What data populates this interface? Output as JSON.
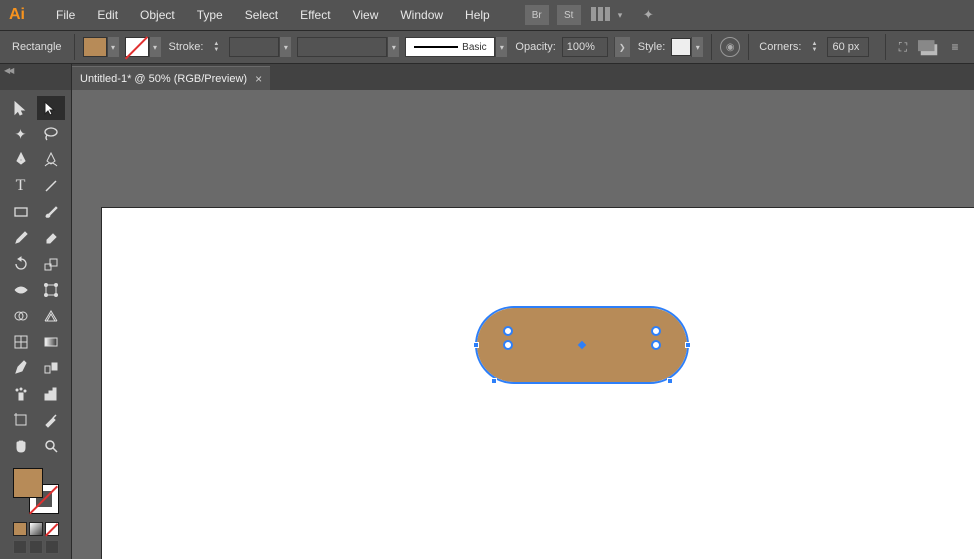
{
  "app_icon_text": "Ai",
  "menu": [
    "File",
    "Edit",
    "Object",
    "Type",
    "Select",
    "Effect",
    "View",
    "Window",
    "Help"
  ],
  "bridge_label": "Br",
  "stock_label": "St",
  "controlbar": {
    "shape_label": "Rectangle",
    "stroke_label": "Stroke:",
    "brush_label": "Basic",
    "opacity_label": "Opacity:",
    "opacity_value": "100%",
    "style_label": "Style:",
    "corners_label": "Corners:",
    "corners_value": "60 px"
  },
  "tab": {
    "title": "Untitled-1* @ 50% (RGB/Preview)",
    "close": "×"
  },
  "colors": {
    "fill": "#b78b58",
    "selection": "#2d7ff9"
  },
  "tools": [
    [
      "selection-tool",
      "direct-selection-tool"
    ],
    [
      "magic-wand-tool",
      "lasso-tool"
    ],
    [
      "pen-tool",
      "curvature-tool"
    ],
    [
      "type-tool",
      "line-segment-tool"
    ],
    [
      "rectangle-tool",
      "paintbrush-tool"
    ],
    [
      "shaper-tool",
      "eraser-tool"
    ],
    [
      "rotate-tool",
      "scale-tool"
    ],
    [
      "width-tool",
      "free-transform-tool"
    ],
    [
      "shape-builder-tool",
      "perspective-grid-tool"
    ],
    [
      "mesh-tool",
      "gradient-tool"
    ],
    [
      "eyedropper-tool",
      "blend-tool"
    ],
    [
      "symbol-sprayer-tool",
      "column-graph-tool"
    ],
    [
      "artboard-tool",
      "slice-tool"
    ],
    [
      "hand-tool",
      "zoom-tool"
    ]
  ]
}
